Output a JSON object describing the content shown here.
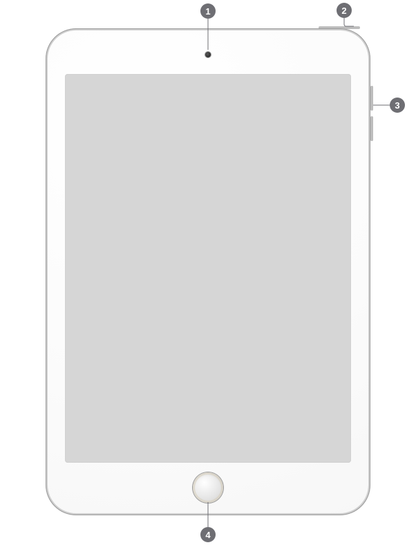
{
  "colors": {
    "badge_bg": "#6E6E73",
    "badge_fg": "#FFFFFF",
    "screen": "#D6D6D6"
  },
  "device": {
    "kind": "tablet-front"
  },
  "parts": {
    "front_camera": {
      "name": "front-camera"
    },
    "home_button": {
      "name": "home-button"
    },
    "top_button": {
      "name": "top-button"
    },
    "volume": {
      "name": "volume-buttons"
    }
  },
  "callouts": [
    {
      "n": "1",
      "points_to": "front-camera"
    },
    {
      "n": "2",
      "points_to": "top-button"
    },
    {
      "n": "3",
      "points_to": "volume-buttons"
    },
    {
      "n": "4",
      "points_to": "home-button"
    }
  ]
}
